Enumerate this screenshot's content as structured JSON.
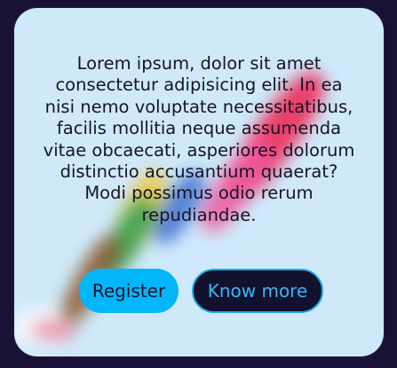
{
  "card": {
    "text": "Lorem ipsum, dolor sit amet consectetur adipisicing elit. In ea nisi nemo voluptate necessitatibus, facilis mollitia neque assumenda vitae obcaecati, asperiores dolorum distinctio accusantium quaerat? Modi possimus odio rerum repudiandae."
  },
  "buttons": {
    "register_label": "Register",
    "know_more_label": "Know more"
  },
  "colors": {
    "page_background": "#1a1236",
    "card_background": "#cfe9fb",
    "primary_button": "#03b6f7",
    "secondary_button": "#12112e",
    "secondary_button_border": "#1ea8e8"
  }
}
